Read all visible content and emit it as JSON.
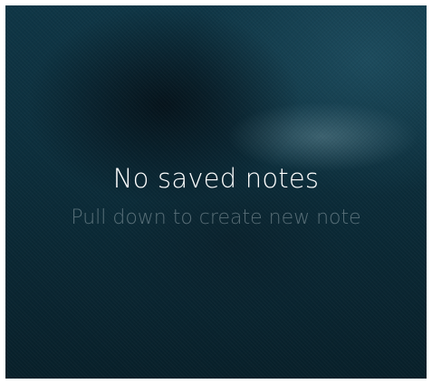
{
  "notes": {
    "empty_title": "No saved notes",
    "empty_hint": "Pull down to create new note"
  },
  "colors": {
    "background": "#0c2e3c",
    "title_text": "#ffffff",
    "hint_text": "#7d9299"
  }
}
